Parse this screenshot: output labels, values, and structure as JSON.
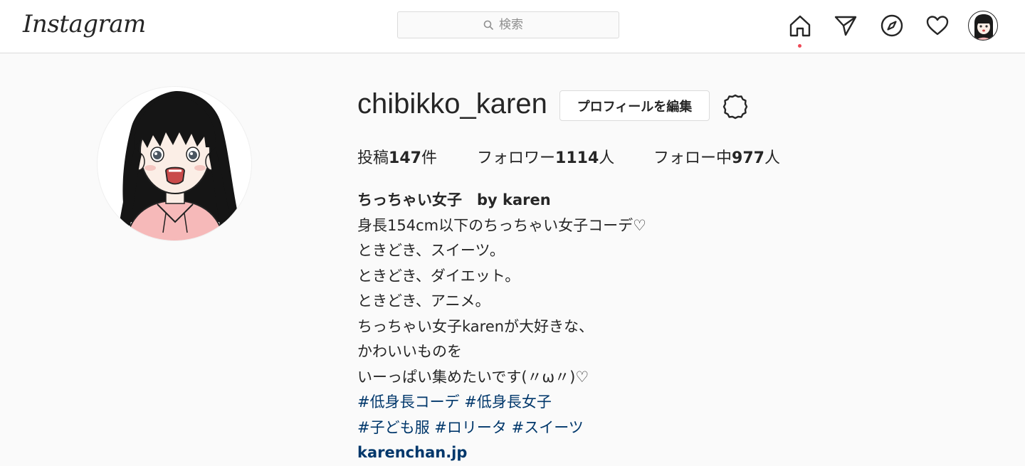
{
  "header": {
    "logo": "Instagram",
    "search_placeholder": "検索",
    "icons": [
      "home-icon",
      "direct-icon",
      "explore-icon",
      "activity-icon",
      "profile-avatar"
    ],
    "notification_dot_color": "#ed4956"
  },
  "profile": {
    "username": "chibikko_karen",
    "edit_button": "プロフィールを編集",
    "stats": {
      "posts_label": "投稿",
      "posts_count": "147",
      "posts_unit": "件",
      "followers_label": "フォロワー",
      "followers_count": "1114",
      "followers_unit": "人",
      "following_label": "フォロー中",
      "following_count": "977",
      "following_unit": "人"
    },
    "full_name": "ちっちゃい女子　by karen",
    "bio_lines": [
      "身長154cm以下のちっちゃい女子コーデ♡",
      "ときどき、スイーツ。",
      "ときどき、ダイエット。",
      "ときどき、アニメ。",
      "ちっちゃい女子karenが大好きな、",
      "かわいいものを",
      "いーっぱい集めたいです(〃ω〃)♡"
    ],
    "hashtag_lines": [
      [
        "#低身長コーデ",
        "#低身長女子"
      ],
      [
        "#子ども服",
        "#ロリータ",
        "#スイーツ"
      ]
    ],
    "website": "karenchan.jp",
    "link_color": "#00376b"
  }
}
